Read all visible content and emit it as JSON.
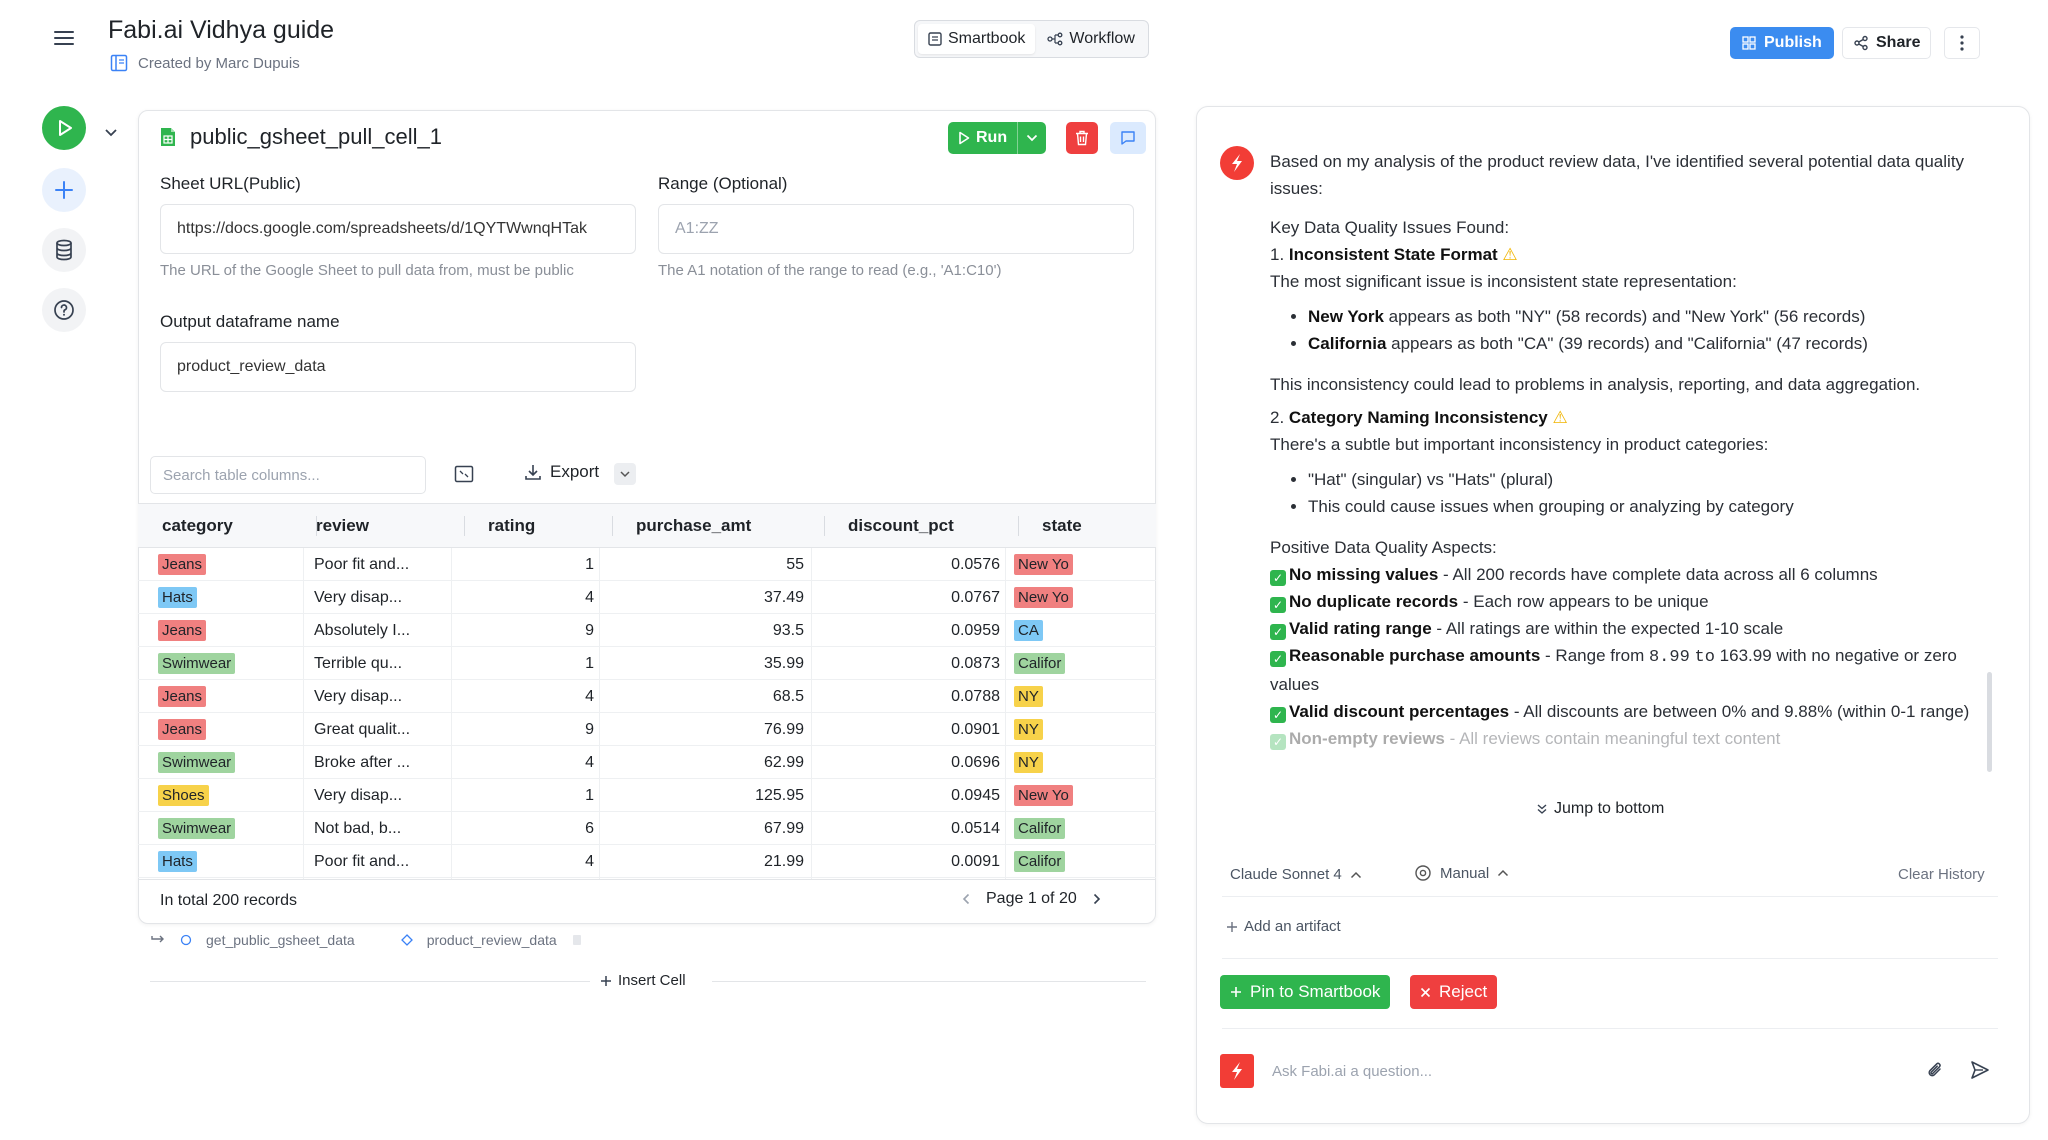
{
  "header": {
    "title": "Fabi.ai Vidhya guide",
    "created_by": "Created by Marc Dupuis",
    "modes": [
      "Smartbook",
      "Workflow"
    ],
    "publish_label": "Publish",
    "share_label": "Share"
  },
  "cell": {
    "title": "public_gsheet_pull_cell_1",
    "run_label": "Run",
    "sheet_url_label": "Sheet URL(Public)",
    "sheet_url_value": "https://docs.google.com/spreadsheets/d/1QYTWwnqHTak",
    "sheet_url_help": "The URL of the Google Sheet to pull data from, must be public",
    "range_label": "Range (Optional)",
    "range_placeholder": "A1:ZZ",
    "range_help": "The A1 notation of the range to read (e.g., 'A1:C10')",
    "output_label": "Output dataframe name",
    "output_value": "product_review_data",
    "search_placeholder": "Search table columns...",
    "export_label": "Export"
  },
  "table": {
    "columns": [
      "category",
      "review",
      "rating",
      "purchase_amt",
      "discount_pct",
      "state"
    ],
    "rows": [
      {
        "category": "Jeans",
        "review": "Poor fit and...",
        "rating": "1",
        "purchase_amt": "55",
        "discount_pct": "0.0576",
        "state": "New Yo"
      },
      {
        "category": "Hats",
        "review": "Very disap...",
        "rating": "4",
        "purchase_amt": "37.49",
        "discount_pct": "0.0767",
        "state": "New Yo"
      },
      {
        "category": "Jeans",
        "review": "Absolutely I...",
        "rating": "9",
        "purchase_amt": "93.5",
        "discount_pct": "0.0959",
        "state": "CA"
      },
      {
        "category": "Swimwear",
        "review": "Terrible qu...",
        "rating": "1",
        "purchase_amt": "35.99",
        "discount_pct": "0.0873",
        "state": "Califor"
      },
      {
        "category": "Jeans",
        "review": "Very disap...",
        "rating": "4",
        "purchase_amt": "68.5",
        "discount_pct": "0.0788",
        "state": "NY"
      },
      {
        "category": "Jeans",
        "review": "Great qualit...",
        "rating": "9",
        "purchase_amt": "76.99",
        "discount_pct": "0.0901",
        "state": "NY"
      },
      {
        "category": "Swimwear",
        "review": "Broke after ...",
        "rating": "4",
        "purchase_amt": "62.99",
        "discount_pct": "0.0696",
        "state": "NY"
      },
      {
        "category": "Shoes",
        "review": "Very disap...",
        "rating": "1",
        "purchase_amt": "125.95",
        "discount_pct": "0.0945",
        "state": "New Yo"
      },
      {
        "category": "Swimwear",
        "review": "Not bad, b...",
        "rating": "6",
        "purchase_amt": "67.99",
        "discount_pct": "0.0514",
        "state": "Califor"
      },
      {
        "category": "Hats",
        "review": "Poor fit and...",
        "rating": "4",
        "purchase_amt": "21.99",
        "discount_pct": "0.0091",
        "state": "Califor"
      }
    ],
    "total_label": "In total 200 records",
    "page_label": "Page 1 of 20"
  },
  "tag_colors": {
    "Jeans": "#f08080",
    "Hats": "#7ec8f5",
    "Swimwear": "#9fd49f",
    "Shoes": "#f7d24a",
    "New Yo": "#f08080",
    "CA": "#7ec8f5",
    "Califor": "#9fd49f",
    "NY": "#f7d24a"
  },
  "lineage": {
    "source": "get_public_gsheet_data",
    "output": "product_review_data"
  },
  "insert_cell_label": "Insert Cell",
  "chat": {
    "intro": "Based on my analysis of the product review data, I've identified several potential data quality issues:",
    "key_issues_heading": "Key Data Quality Issues Found:",
    "issue1_num": "1.",
    "issue1_title": "Inconsistent State Format",
    "issue1_desc": "The most significant issue is inconsistent state representation:",
    "issue1_b1_bold": "New York",
    "issue1_b1_rest": "appears as both \"NY\" (58 records) and \"New York\" (56 records)",
    "issue1_b2_bold": "California",
    "issue1_b2_rest": "appears as both \"CA\" (39 records) and \"California\" (47 records)",
    "issue1_impact": "This inconsistency could lead to problems in analysis, reporting, and data aggregation.",
    "issue2_num": "2.",
    "issue2_title": "Category Naming Inconsistency",
    "issue2_desc": "There's a subtle but important inconsistency in product categories:",
    "issue2_b1": "\"Hat\" (singular) vs \"Hats\" (plural)",
    "issue2_b2": "This could cause issues when grouping or analyzing by category",
    "positive_heading": "Positive Data Quality Aspects:",
    "pos1_bold": "No missing values",
    "pos1_rest": "- All 200 records have complete data across all 6 columns",
    "pos2_bold": "No duplicate records",
    "pos2_rest": "- Each row appears to be unique",
    "pos3_bold": "Valid rating range",
    "pos3_rest": "- All ratings are within the expected 1-10 scale",
    "pos4_bold": "Reasonable purchase amounts",
    "pos4_pre": "- Range from",
    "pos4_low": "8.99",
    "pos4_to": "to",
    "pos4_rest": "163.99 with no negative or zero values",
    "pos5_bold": "Valid discount percentages",
    "pos5_rest": "- All discounts are between 0% and 9.88% (within 0-1 range)",
    "pos6_bold": "Non-empty reviews",
    "pos6_rest": "- All reviews contain meaningful text content",
    "jump_label": "Jump to bottom",
    "model_label": "Claude Sonnet 4",
    "mode_label": "Manual",
    "clear_label": "Clear History",
    "add_artifact_label": "Add an artifact",
    "pin_label": "Pin to Smartbook",
    "reject_label": "Reject",
    "ask_placeholder": "Ask Fabi.ai a question..."
  }
}
